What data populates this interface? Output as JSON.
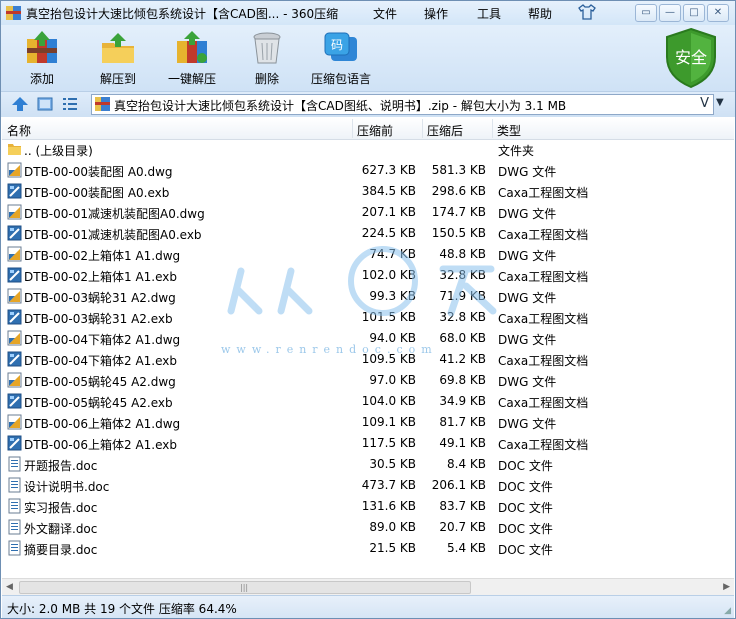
{
  "window": {
    "title": "真空抬包设计大速比倾包系统设计【含CAD图... - 360压缩",
    "menus": [
      "文件",
      "操作",
      "工具",
      "帮助"
    ],
    "controls": [
      "shirt-icon",
      "menu-icon",
      "minimize-icon",
      "maximize-icon",
      "close-icon"
    ]
  },
  "toolbar": {
    "add": "添加",
    "extract": "解压到",
    "one_click": "一键解压",
    "delete": "删除",
    "language": "压缩包语言",
    "security_badge": "安全"
  },
  "address": {
    "path": "真空抬包设计大速比倾包系统设计【含CAD图纸、说明书】.zip - 解包大小为 3.1 MB",
    "chevron": "V"
  },
  "columns": {
    "name": "名称",
    "compressed_before": "压缩前",
    "compressed_after": "压缩后",
    "type": "类型"
  },
  "files": [
    {
      "name": ".. (上级目录)",
      "before": "",
      "after": "",
      "type": "文件夹",
      "icon": "folder"
    },
    {
      "name": "DTB-00-00装配图 A0.dwg",
      "before": "627.3 KB",
      "after": "581.3 KB",
      "type": "DWG 文件",
      "icon": "dwg"
    },
    {
      "name": "DTB-00-00装配图 A0.exb",
      "before": "384.5 KB",
      "after": "298.6 KB",
      "type": "Caxa工程图文档",
      "icon": "exb"
    },
    {
      "name": "DTB-00-01减速机装配图A0.dwg",
      "before": "207.1 KB",
      "after": "174.7 KB",
      "type": "DWG 文件",
      "icon": "dwg"
    },
    {
      "name": "DTB-00-01减速机装配图A0.exb",
      "before": "224.5 KB",
      "after": "150.5 KB",
      "type": "Caxa工程图文档",
      "icon": "exb"
    },
    {
      "name": "DTB-00-02上箱体1  A1.dwg",
      "before": "74.7 KB",
      "after": "48.8 KB",
      "type": "DWG 文件",
      "icon": "dwg"
    },
    {
      "name": "DTB-00-02上箱体1  A1.exb",
      "before": "102.0 KB",
      "after": "32.8 KB",
      "type": "Caxa工程图文档",
      "icon": "exb"
    },
    {
      "name": "DTB-00-03蜗轮31  A2.dwg",
      "before": "99.3 KB",
      "after": "71.9 KB",
      "type": "DWG 文件",
      "icon": "dwg"
    },
    {
      "name": "DTB-00-03蜗轮31  A2.exb",
      "before": "101.5 KB",
      "after": "32.8 KB",
      "type": "Caxa工程图文档",
      "icon": "exb"
    },
    {
      "name": "DTB-00-04下箱体2  A1.dwg",
      "before": "94.0 KB",
      "after": "68.0 KB",
      "type": "DWG 文件",
      "icon": "dwg"
    },
    {
      "name": "DTB-00-04下箱体2  A1.exb",
      "before": "109.5 KB",
      "after": "41.2 KB",
      "type": "Caxa工程图文档",
      "icon": "exb"
    },
    {
      "name": "DTB-00-05蜗轮45  A2.dwg",
      "before": "97.0 KB",
      "after": "69.8 KB",
      "type": "DWG 文件",
      "icon": "dwg"
    },
    {
      "name": "DTB-00-05蜗轮45  A2.exb",
      "before": "104.0 KB",
      "after": "34.9 KB",
      "type": "Caxa工程图文档",
      "icon": "exb"
    },
    {
      "name": "DTB-00-06上箱体2  A1.dwg",
      "before": "109.1 KB",
      "after": "81.7 KB",
      "type": "DWG 文件",
      "icon": "dwg"
    },
    {
      "name": "DTB-00-06上箱体2  A1.exb",
      "before": "117.5 KB",
      "after": "49.1 KB",
      "type": "Caxa工程图文档",
      "icon": "exb"
    },
    {
      "name": "开题报告.doc",
      "before": "30.5 KB",
      "after": "8.4 KB",
      "type": "DOC 文件",
      "icon": "doc"
    },
    {
      "name": "设计说明书.doc",
      "before": "473.7 KB",
      "after": "206.1 KB",
      "type": "DOC 文件",
      "icon": "doc"
    },
    {
      "name": "实习报告.doc",
      "before": "131.6 KB",
      "after": "83.7 KB",
      "type": "DOC 文件",
      "icon": "doc"
    },
    {
      "name": "外文翻译.doc",
      "before": "89.0 KB",
      "after": "20.7 KB",
      "type": "DOC 文件",
      "icon": "doc"
    },
    {
      "name": "摘要目录.doc",
      "before": "21.5 KB",
      "after": "5.4 KB",
      "type": "DOC 文件",
      "icon": "doc"
    }
  ],
  "status": {
    "text": "大小: 2.0 MB 共 19 个文件 压缩率 64.4%"
  },
  "watermark": {
    "url": "www.renrendoc.com"
  },
  "colors": {
    "accent": "#2a6fc4",
    "shield_green": "#3d9a2c",
    "watermark": "#8cc3ee"
  }
}
